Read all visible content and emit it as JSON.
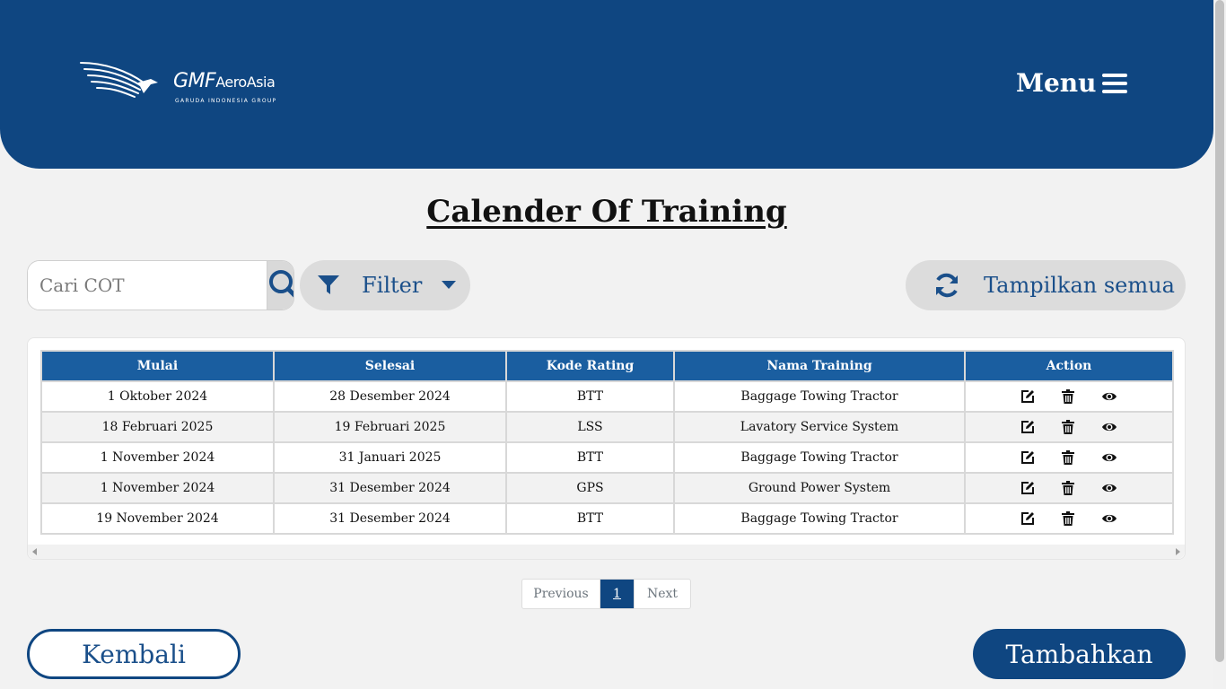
{
  "header": {
    "logo": {
      "brand": "GMF",
      "brand_suffix": "AeroAsia",
      "tagline": "GARUDA INDONESIA GROUP"
    },
    "menu_label": "Menu"
  },
  "page_title": "Calender Of Training",
  "search": {
    "placeholder": "Cari COT",
    "value": ""
  },
  "filter_label": "Filter",
  "show_all_label": "Tampilkan semua",
  "table": {
    "columns": [
      "Mulai",
      "Selesai",
      "Kode Rating",
      "Nama Training",
      "Action"
    ],
    "rows": [
      {
        "mulai": "1 Oktober 2024",
        "selesai": "28 Desember 2024",
        "kode": "BTT",
        "nama": "Baggage Towing Tractor"
      },
      {
        "mulai": "18 Februari 2025",
        "selesai": "19 Februari 2025",
        "kode": "LSS",
        "nama": "Lavatory Service System"
      },
      {
        "mulai": "1 November 2024",
        "selesai": "31 Januari 2025",
        "kode": "BTT",
        "nama": "Baggage Towing Tractor"
      },
      {
        "mulai": "1 November 2024",
        "selesai": "31 Desember 2024",
        "kode": "GPS",
        "nama": "Ground Power System"
      },
      {
        "mulai": "19 November 2024",
        "selesai": "31 Desember 2024",
        "kode": "BTT",
        "nama": "Baggage Towing Tractor"
      }
    ],
    "action_icons": [
      "edit-icon",
      "trash-icon",
      "eye-icon"
    ]
  },
  "pagination": {
    "previous": "Previous",
    "current": "1",
    "next": "Next"
  },
  "back_label": "Kembali",
  "add_label": "Tambahkan",
  "colors": {
    "primary": "#0f4681",
    "table_header": "#1a5ea0",
    "background": "#f2f2f2"
  }
}
